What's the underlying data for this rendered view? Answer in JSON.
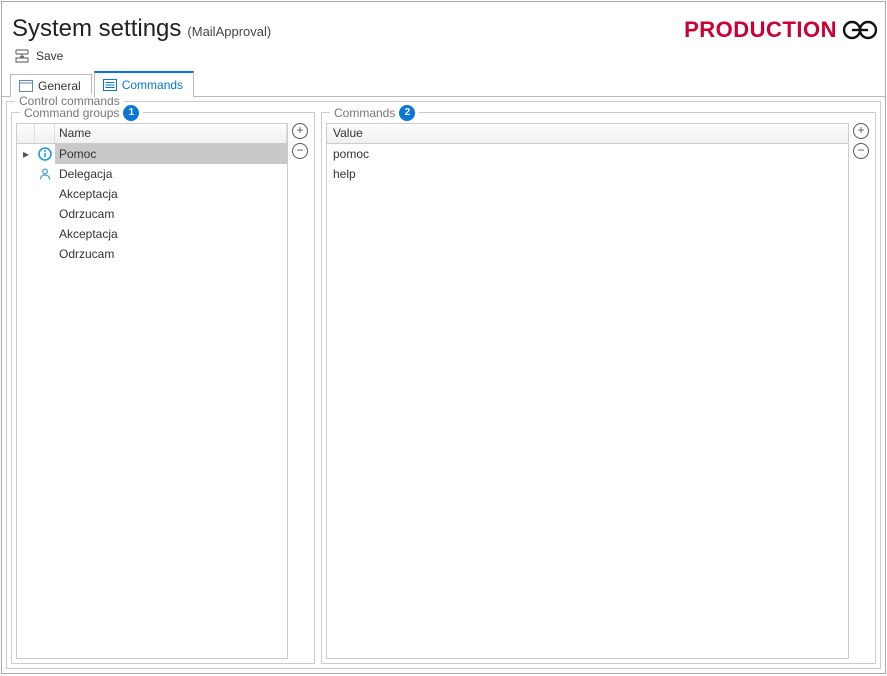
{
  "header": {
    "title": "System settings",
    "subtitle": "(MailApproval)",
    "environment": "PRODUCTION"
  },
  "toolbar": {
    "save_label": "Save"
  },
  "tabs": {
    "general": "General",
    "commands": "Commands"
  },
  "panel": {
    "control_commands": "Control commands",
    "command_groups": "Command groups",
    "commands": "Commands",
    "badge1": "1",
    "badge2": "2"
  },
  "grid_groups": {
    "header_name": "Name",
    "rows": [
      {
        "name": "Pomoc",
        "icon": "info",
        "selected": true
      },
      {
        "name": "Delegacja",
        "icon": "person",
        "selected": false
      },
      {
        "name": "Akceptacja",
        "icon": "",
        "selected": false
      },
      {
        "name": "Odrzucam",
        "icon": "",
        "selected": false
      },
      {
        "name": "Akceptacja",
        "icon": "",
        "selected": false
      },
      {
        "name": "Odrzucam",
        "icon": "",
        "selected": false
      }
    ]
  },
  "grid_commands": {
    "header_value": "Value",
    "rows": [
      {
        "value": "pomoc"
      },
      {
        "value": "help"
      }
    ]
  }
}
